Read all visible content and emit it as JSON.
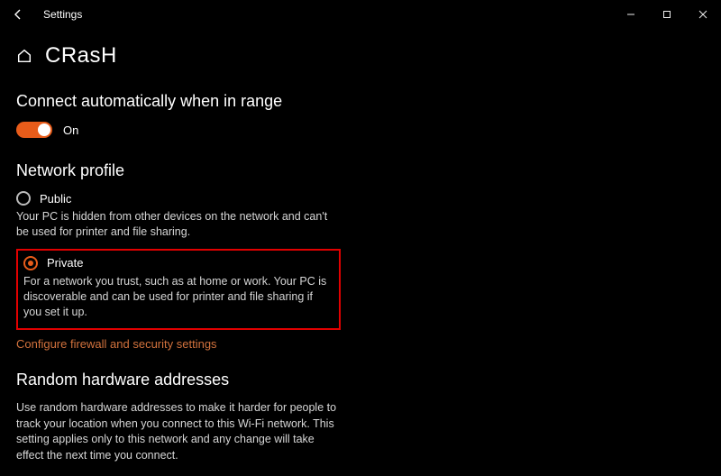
{
  "window": {
    "title": "Settings"
  },
  "header": {
    "title": "CRasH"
  },
  "auto_connect": {
    "heading": "Connect automatically when in range",
    "toggle_state": "On"
  },
  "network_profile": {
    "heading": "Network profile",
    "public": {
      "label": "Public",
      "desc": "Your PC is hidden from other devices on the network and can't be used for printer and file sharing."
    },
    "private": {
      "label": "Private",
      "desc": "For a network you trust, such as at home or work. Your PC is discoverable and can be used for printer and file sharing if you set it up."
    },
    "link": "Configure firewall and security settings"
  },
  "random_mac": {
    "heading": "Random hardware addresses",
    "desc": "Use random hardware addresses to make it harder for people to track your location when you connect to this Wi-Fi network. This setting applies only to this network and any change will take effect the next time you connect."
  }
}
